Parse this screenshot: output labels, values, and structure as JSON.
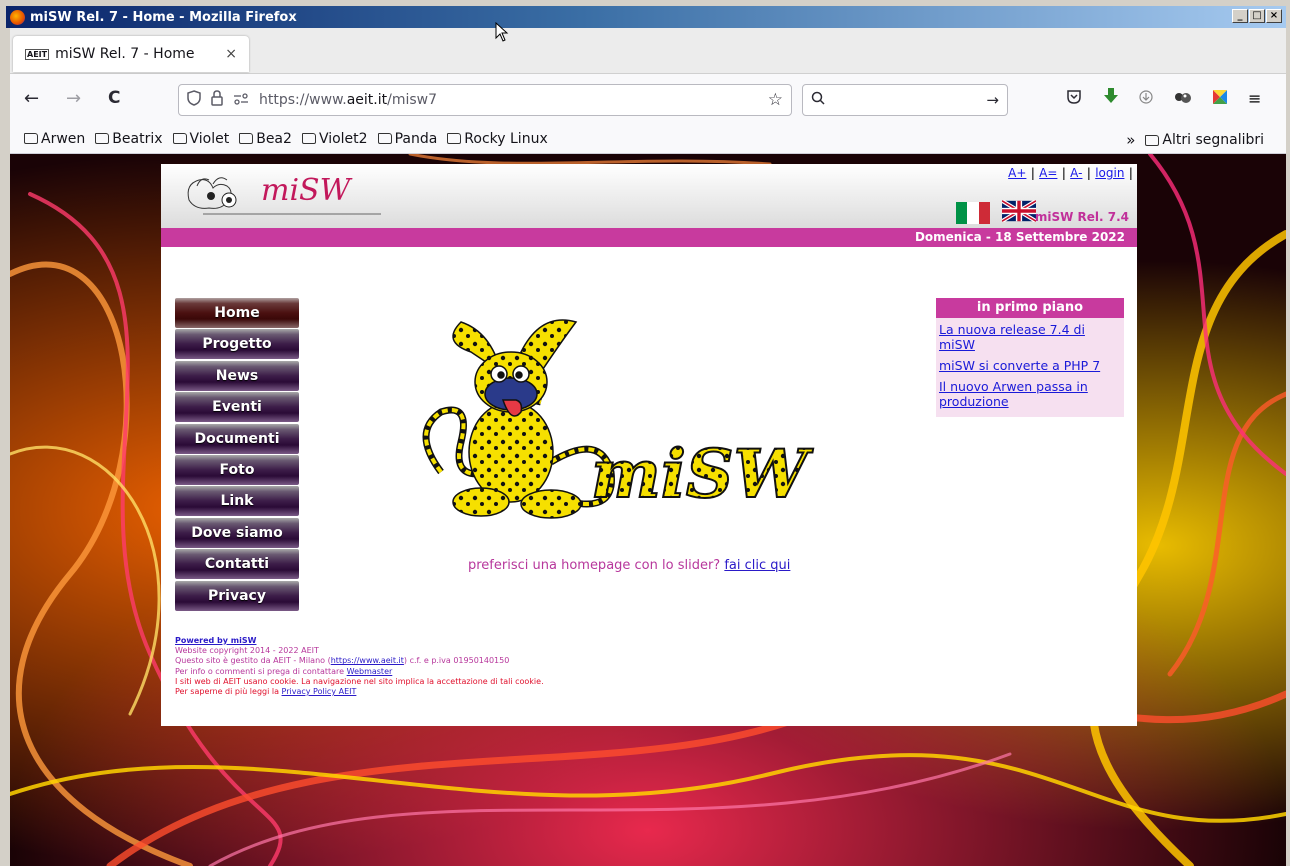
{
  "window": {
    "title": "miSW Rel. 7 - Home - Mozilla Firefox",
    "controls": [
      "_",
      "□",
      "×"
    ]
  },
  "tab": {
    "favicon_text": "AEIT",
    "title": "miSW Rel. 7 - Home",
    "close": "×"
  },
  "nav": {
    "back": "←",
    "forward": "→",
    "reload": "C",
    "url_prefix": "https://www.",
    "url_domain": "aeit.it",
    "url_path": "/misw7",
    "search_placeholder": "",
    "search_go": "→"
  },
  "bookmarks": {
    "items": [
      "Arwen",
      "Beatrix",
      "Violet",
      "Bea2",
      "Violet2",
      "Panda",
      "Rocky Linux"
    ],
    "overflow": "»",
    "other": "Altri segnalibri"
  },
  "site": {
    "logo_text": "miSW",
    "links": [
      "A+",
      "A=",
      "A-",
      "login"
    ],
    "release": "miSW Rel. 7.4",
    "date": "Domenica - 18 Settembre 2022",
    "menu": [
      "Home",
      "Progetto",
      "News",
      "Eventi",
      "Documenti",
      "Foto",
      "Link",
      "Dove siamo",
      "Contatti",
      "Privacy"
    ],
    "mascot_text": "miSW",
    "slider_text": "preferisci una homepage con lo slider?",
    "slider_link": "fai clic qui",
    "featured_title": "in primo piano",
    "featured": [
      "La nuova release 7.4 di miSW",
      "miSW si converte a PHP 7",
      "Il nuovo Arwen passa in produzione"
    ],
    "footer": {
      "powered": "Powered by miSW",
      "copyright": "Website copyright 2014 - 2022 AEIT",
      "managed_pre": "Questo sito è gestito da AEIT - Milano (",
      "managed_link": "https://www.aeit.it",
      "managed_post": ") c.f. e p.iva 01950140150",
      "contact_pre": "Per info o commenti si prega di contattare ",
      "contact_link": "Webmaster",
      "cookies": "I siti web di AEIT usano cookie. La navigazione nel sito implica la accettazione di tali cookie.",
      "privacy_pre": "Per saperne di più leggi la ",
      "privacy_link": "Privacy Policy AEIT"
    }
  },
  "colors": {
    "accent": "#c83a9e",
    "link": "#1a1ad8",
    "titlebar": "#0a246a"
  }
}
